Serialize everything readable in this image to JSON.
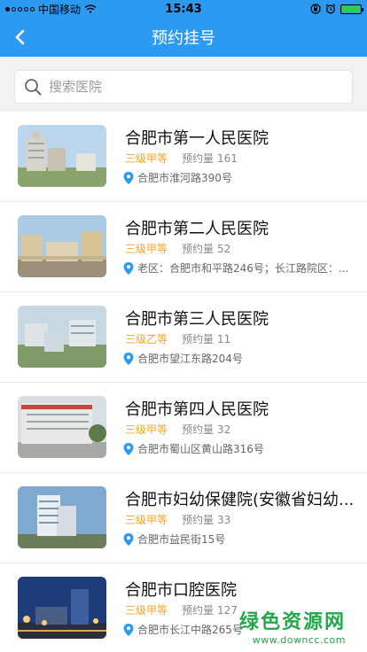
{
  "status_bar": {
    "carrier": "中国移动",
    "time": "15:43"
  },
  "nav": {
    "title": "预约挂号"
  },
  "search": {
    "placeholder": "搜索医院",
    "value": ""
  },
  "count_label": "预约量",
  "hospitals": [
    {
      "name": "合肥市第一人民医院",
      "level": "三级甲等",
      "count": "161",
      "address": "合肥市淮河路390号"
    },
    {
      "name": "合肥市第二人民医院",
      "level": "三级甲等",
      "count": "52",
      "address": "老区：合肥市和平路246号；长江路院区：..."
    },
    {
      "name": "合肥市第三人民医院",
      "level": "三级乙等",
      "count": "11",
      "address": "合肥市望江东路204号"
    },
    {
      "name": "合肥市第四人民医院",
      "level": "三级甲等",
      "count": "32",
      "address": "合肥市蜀山区黄山路316号"
    },
    {
      "name": "合肥市妇幼保健院(安徽省妇幼...",
      "level": "三级甲等",
      "count": "33",
      "address": "合肥市益民街15号"
    },
    {
      "name": "合肥市口腔医院",
      "level": "三级甲等",
      "count": "127",
      "address": "合肥市长江中路265号"
    }
  ],
  "watermark": {
    "title": "绿色资源网",
    "url": "www.downcc.com"
  },
  "colors": {
    "accent": "#2d9af2",
    "level": "#f5a623",
    "location_pin": "#2d9af2"
  }
}
